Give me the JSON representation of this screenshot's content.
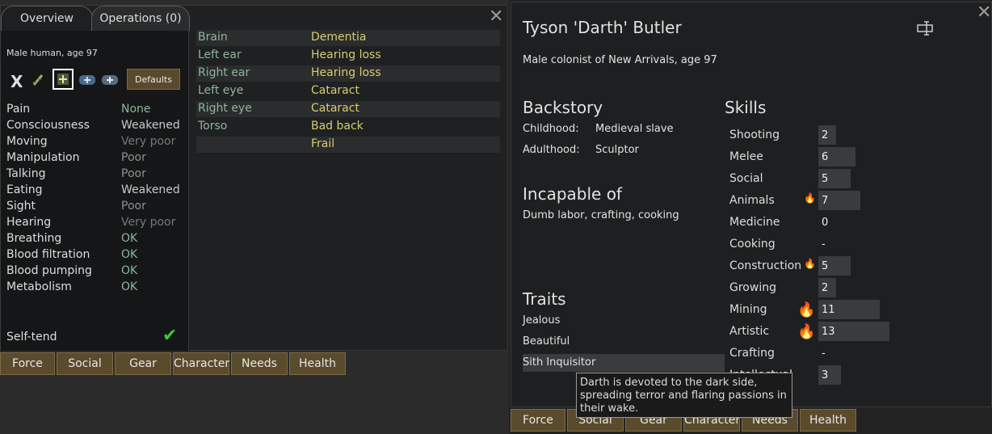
{
  "health": {
    "tabs": {
      "overview": "Overview",
      "operations": "Operations (0)"
    },
    "description": "Male human, age 97",
    "icons": {
      "x": "X"
    },
    "defaults_label": "Defaults",
    "capacities": [
      {
        "name": "Pain",
        "value": "None",
        "color": "#8fb69b"
      },
      {
        "name": "Consciousness",
        "value": "Weakened",
        "color": "#c8c8c8"
      },
      {
        "name": "Moving",
        "value": "Very poor",
        "color": "#777777"
      },
      {
        "name": "Manipulation",
        "value": "Poor",
        "color": "#909090"
      },
      {
        "name": "Talking",
        "value": "Poor",
        "color": "#909090"
      },
      {
        "name": "Eating",
        "value": "Weakened",
        "color": "#c8c8c8"
      },
      {
        "name": "Sight",
        "value": "Poor",
        "color": "#909090"
      },
      {
        "name": "Hearing",
        "value": "Very poor",
        "color": "#777777"
      },
      {
        "name": "Breathing",
        "value": "OK",
        "color": "#8fb69b"
      },
      {
        "name": "Blood filtration",
        "value": "OK",
        "color": "#8fb69b"
      },
      {
        "name": "Blood pumping",
        "value": "OK",
        "color": "#8fb69b"
      },
      {
        "name": "Metabolism",
        "value": "OK",
        "color": "#8fb69b"
      }
    ],
    "self_tend": "Self-tend",
    "hediffs": [
      {
        "part": "Brain",
        "condition": "Dementia"
      },
      {
        "part": "Left ear",
        "condition": "Hearing loss"
      },
      {
        "part": "Right ear",
        "condition": "Hearing loss"
      },
      {
        "part": "Left eye",
        "condition": "Cataract"
      },
      {
        "part": "Right eye",
        "condition": "Cataract"
      },
      {
        "part": "Torso",
        "condition": "Bad back"
      },
      {
        "part": "",
        "condition": "Frail"
      }
    ]
  },
  "bottom_tabs_left": [
    "Force",
    "Social",
    "Gear",
    "Character",
    "Needs",
    "Health"
  ],
  "character": {
    "name": "Tyson 'Darth' Butler",
    "subtitle": "Male colonist of New Arrivals, age 97",
    "backstory": {
      "heading": "Backstory",
      "childhood_label": "Childhood:",
      "childhood": "Medieval slave",
      "adulthood_label": "Adulthood:",
      "adulthood": "Sculptor"
    },
    "incapable": {
      "heading": "Incapable of",
      "text": "Dumb labor, crafting, cooking"
    },
    "traits": {
      "heading": "Traits",
      "items": [
        "Jealous",
        "Beautiful",
        "Sith Inquisitor"
      ]
    },
    "skills_heading": "Skills",
    "skills": [
      {
        "name": "Shooting",
        "value": "2",
        "level": 2,
        "passion": 0
      },
      {
        "name": "Melee",
        "value": "6",
        "level": 6,
        "passion": 0
      },
      {
        "name": "Social",
        "value": "5",
        "level": 5,
        "passion": 0
      },
      {
        "name": "Animals",
        "value": "7",
        "level": 7,
        "passion": 1
      },
      {
        "name": "Medicine",
        "value": "0",
        "level": 0,
        "passion": 0
      },
      {
        "name": "Cooking",
        "value": "-",
        "level": 0,
        "passion": 0
      },
      {
        "name": "Construction",
        "value": "5",
        "level": 5,
        "passion": 1
      },
      {
        "name": "Growing",
        "value": "2",
        "level": 2,
        "passion": 0
      },
      {
        "name": "Mining",
        "value": "11",
        "level": 11,
        "passion": 2
      },
      {
        "name": "Artistic",
        "value": "13",
        "level": 13,
        "passion": 2
      },
      {
        "name": "Crafting",
        "value": "-",
        "level": 0,
        "passion": 0
      },
      {
        "name": "Intellectual",
        "value": "3",
        "level": 3,
        "passion": 0
      }
    ],
    "tooltip": "Darth is devoted to the dark side, spreading terror and flaring passions in their wake."
  },
  "bottom_tabs_right": [
    "Force",
    "Social",
    "Gear",
    "Character",
    "Needs",
    "Health"
  ]
}
